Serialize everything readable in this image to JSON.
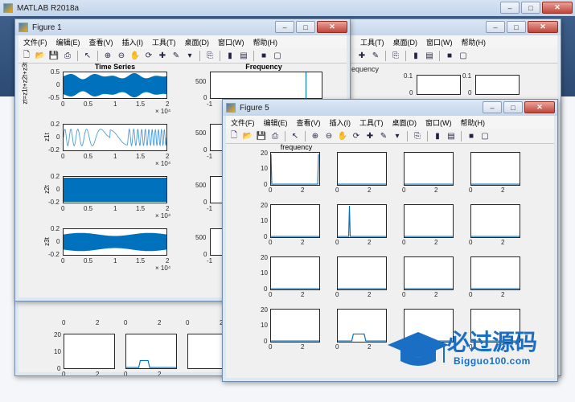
{
  "main_window": {
    "title": "MATLAB R2018a"
  },
  "figure_bg": {
    "menu": [
      "工具(T)",
      "桌面(D)",
      "窗口(W)",
      "帮助(H)"
    ],
    "freq_label": "equency",
    "ticks": [
      "0.1",
      "0",
      "0.1",
      "0",
      "20",
      "10",
      "0",
      "0",
      "2",
      "0",
      "2",
      "20",
      "10",
      "0",
      "0",
      "2",
      "0",
      "2",
      "0",
      "2",
      "0",
      "2",
      "0",
      "2"
    ]
  },
  "figure1": {
    "title": "Figure 1",
    "menu": [
      "文件(F)",
      "编辑(E)",
      "查看(V)",
      "插入(I)",
      "工具(T)",
      "桌面(D)",
      "窗口(W)",
      "帮助(H)"
    ],
    "plot1": {
      "title": "Time Series",
      "ylabel": "zt=z1t+z2t+z3t",
      "yticks": [
        "0.5",
        "0",
        "-0.5"
      ],
      "xticks": [
        "0",
        "0.5",
        "1",
        "1.5",
        "2"
      ],
      "exp": "× 10⁴"
    },
    "plot2": {
      "ylabel": "z1t",
      "yticks": [
        "0.2",
        "0",
        "-0.2"
      ],
      "xticks": [
        "0",
        "0.5",
        "1",
        "1.5",
        "2"
      ],
      "exp": "× 10⁴"
    },
    "plot3": {
      "ylabel": "z2t",
      "yticks": [
        "0.2",
        "0",
        "-0.2"
      ],
      "xticks": [
        "0",
        "0.5",
        "1",
        "1.5",
        "2"
      ],
      "exp": "× 10⁴"
    },
    "plot4": {
      "ylabel": "z3t",
      "yticks": [
        "0.2",
        "0",
        "-0.2"
      ],
      "xticks": [
        "0",
        "0.5",
        "1",
        "1.5",
        "2"
      ],
      "exp": "× 10⁴"
    },
    "freq": {
      "title": "Frequency",
      "yticks": [
        "500",
        "0"
      ],
      "xticks": [
        "-1"
      ]
    }
  },
  "figure5": {
    "title": "Figure 5",
    "menu": [
      "文件(F)",
      "编辑(E)",
      "查看(V)",
      "插入(I)",
      "工具(T)",
      "桌面(D)",
      "窗口(W)",
      "帮助(H)"
    ],
    "title_first": "frequency",
    "yticks": [
      "20",
      "10",
      "0"
    ],
    "xticks": [
      "0",
      "2"
    ]
  },
  "logo": {
    "main": "必过源码",
    "sub": "Bigguo100.com"
  }
}
